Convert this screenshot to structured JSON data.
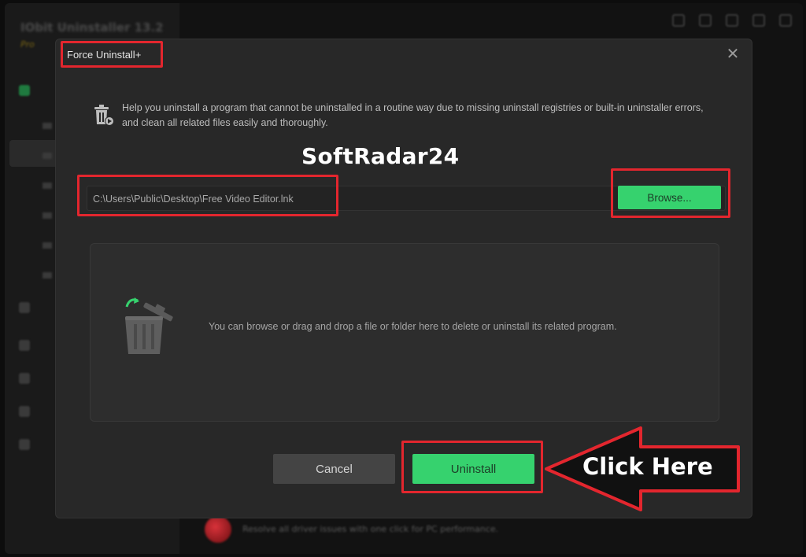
{
  "background_app": {
    "title": "IObit Uninstaller 13.2",
    "edition": "Pro",
    "banner_text": "Resolve all driver issues with one click for PC performance."
  },
  "dialog": {
    "title": "Force Uninstall+",
    "close_icon": "close-icon",
    "help_text": "Help you uninstall a program that cannot be uninstalled in a routine way due to missing uninstall registries or built-in uninstaller errors, and clean all related files easily and thoroughly.",
    "path_value": "C:\\Users\\Public\\Desktop\\Free Video Editor.lnk",
    "browse_label": "Browse...",
    "drop_text": "You can browse or drag and drop a file or folder here to delete or uninstall its related program.",
    "cancel_label": "Cancel",
    "uninstall_label": "Uninstall"
  },
  "annotations": {
    "watermark": "SoftRadar24",
    "callout": "Click Here",
    "highlight_color": "#e3262e"
  },
  "colors": {
    "accent_green": "#36d26e",
    "dialog_bg": "#282828",
    "drop_zone_bg": "#2d2d2d"
  }
}
